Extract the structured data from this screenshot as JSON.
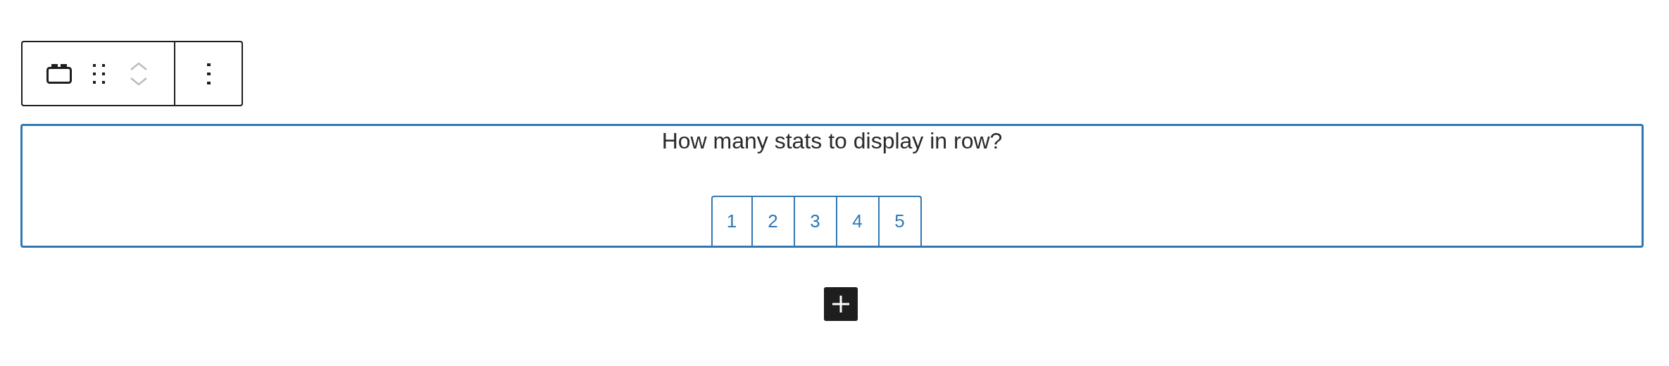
{
  "toolbar": {
    "move_up": {
      "disabled": true
    },
    "move_down": {
      "disabled": true
    }
  },
  "block": {
    "question": "How many stats to display in row?",
    "options": [
      {
        "label": "1"
      },
      {
        "label": "2"
      },
      {
        "label": "3"
      },
      {
        "label": "4"
      },
      {
        "label": "5"
      }
    ]
  }
}
